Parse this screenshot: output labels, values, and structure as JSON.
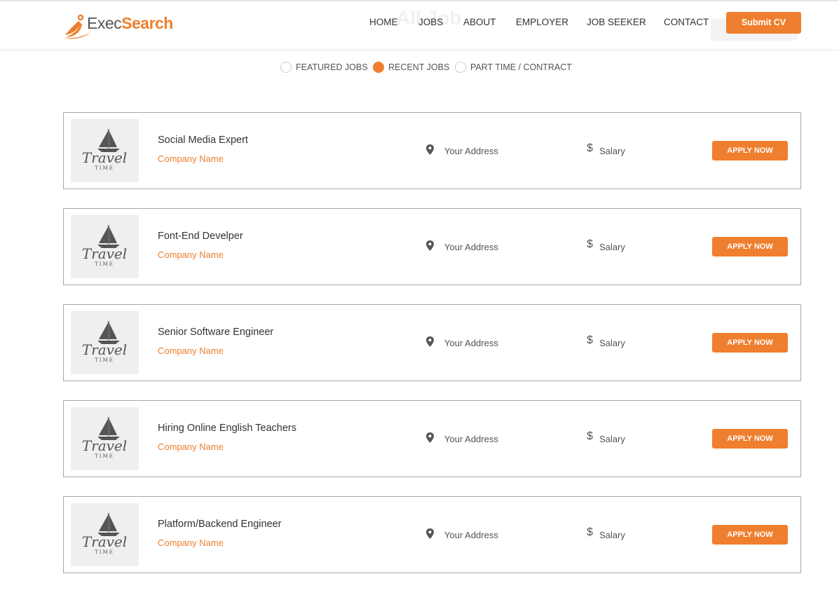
{
  "brand": {
    "name_part1": "Exec",
    "name_part2": "Search",
    "accent_color": "#ef7f2e"
  },
  "ghost_title": "All Job",
  "nav": {
    "items": [
      {
        "label": "HOME"
      },
      {
        "label": "JOBS"
      },
      {
        "label": "ABOUT"
      },
      {
        "label": "EMPLOYER"
      },
      {
        "label": "JOB SEEKER"
      },
      {
        "label": "CONTACT"
      }
    ],
    "submit_label": "Submit CV"
  },
  "tabs": [
    {
      "label": "FEATURED JOBS",
      "selected": false
    },
    {
      "label": "RECENT JOBS",
      "selected": true
    },
    {
      "label": "PART TIME / CONTRACT",
      "selected": false
    }
  ],
  "logo_image": {
    "word": "Travel",
    "sub": "TIME",
    "icon": "sailboat-icon"
  },
  "jobs": [
    {
      "title": "Social Media Expert",
      "company": "Company Name",
      "address": "Your Address",
      "salary": "Salary",
      "apply_label": "APPLY NOW"
    },
    {
      "title": "Font-End Develper",
      "company": "Company Name",
      "address": "Your Address",
      "salary": "Salary",
      "apply_label": "APPLY NOW"
    },
    {
      "title": "Senior Software Engineer",
      "company": "Company Name",
      "address": "Your Address",
      "salary": "Salary",
      "apply_label": "APPLY NOW"
    },
    {
      "title": "Hiring Online English Teachers",
      "company": "Company Name",
      "address": "Your Address",
      "salary": "Salary",
      "apply_label": "APPLY NOW"
    },
    {
      "title": "Platform/Backend Engineer",
      "company": "Company Name",
      "address": "Your Address",
      "salary": "Salary",
      "apply_label": "APPLY NOW"
    }
  ]
}
